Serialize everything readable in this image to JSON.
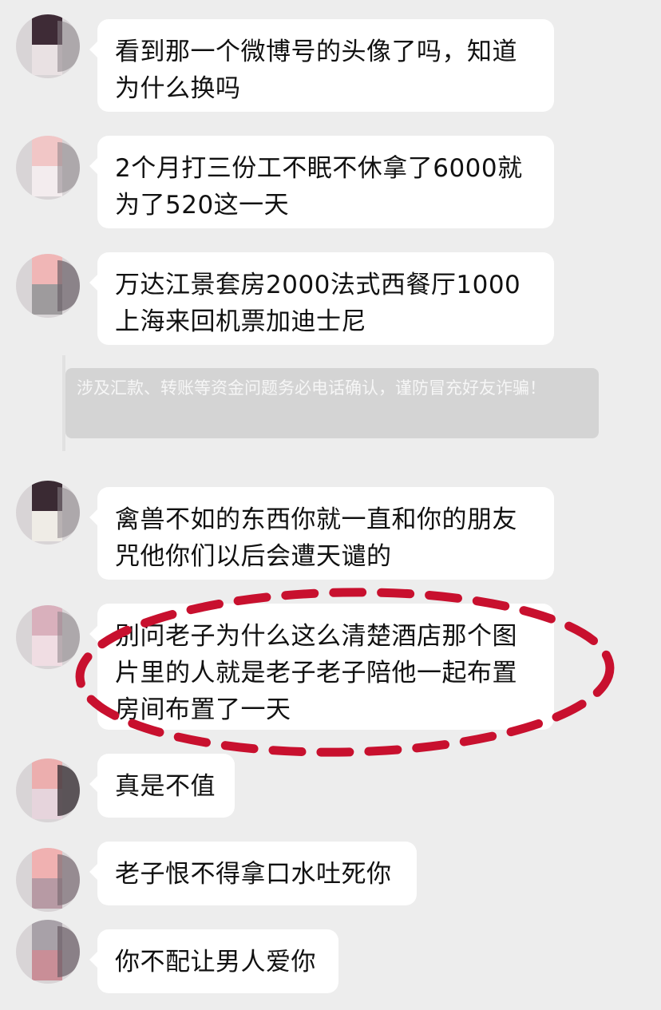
{
  "messages": [
    {
      "text": "看到那一个微博号的头像了吗，知道为什么换吗"
    },
    {
      "text": "2个月打三份工不眠不休拿了6000就为了520这一天"
    },
    {
      "text": "万达江景套房2000法式西餐厅1000上海来回机票加迪士尼"
    },
    {
      "text": "禽兽不如的东西你就一直和你的朋友咒他你们以后会遭天谴的"
    },
    {
      "text": "别问老子为什么这么清楚酒店那个图片里的人就是老子老子陪他一起布置房间布置了一天"
    },
    {
      "text": "真是不值"
    },
    {
      "text": "老子恨不得拿口水吐死你"
    },
    {
      "text": "你不配让男人爱你"
    }
  ],
  "system_notice": "涉及汇款、转账等资金问题务必电话确认，谨防冒充好友诈骗！",
  "colors": {
    "background": "#ededed",
    "bubble": "#ffffff",
    "notice_bg": "#d4d4d4",
    "highlight_ellipse": "#c8102e"
  },
  "icons": {
    "avatar": "avatar-icon"
  }
}
